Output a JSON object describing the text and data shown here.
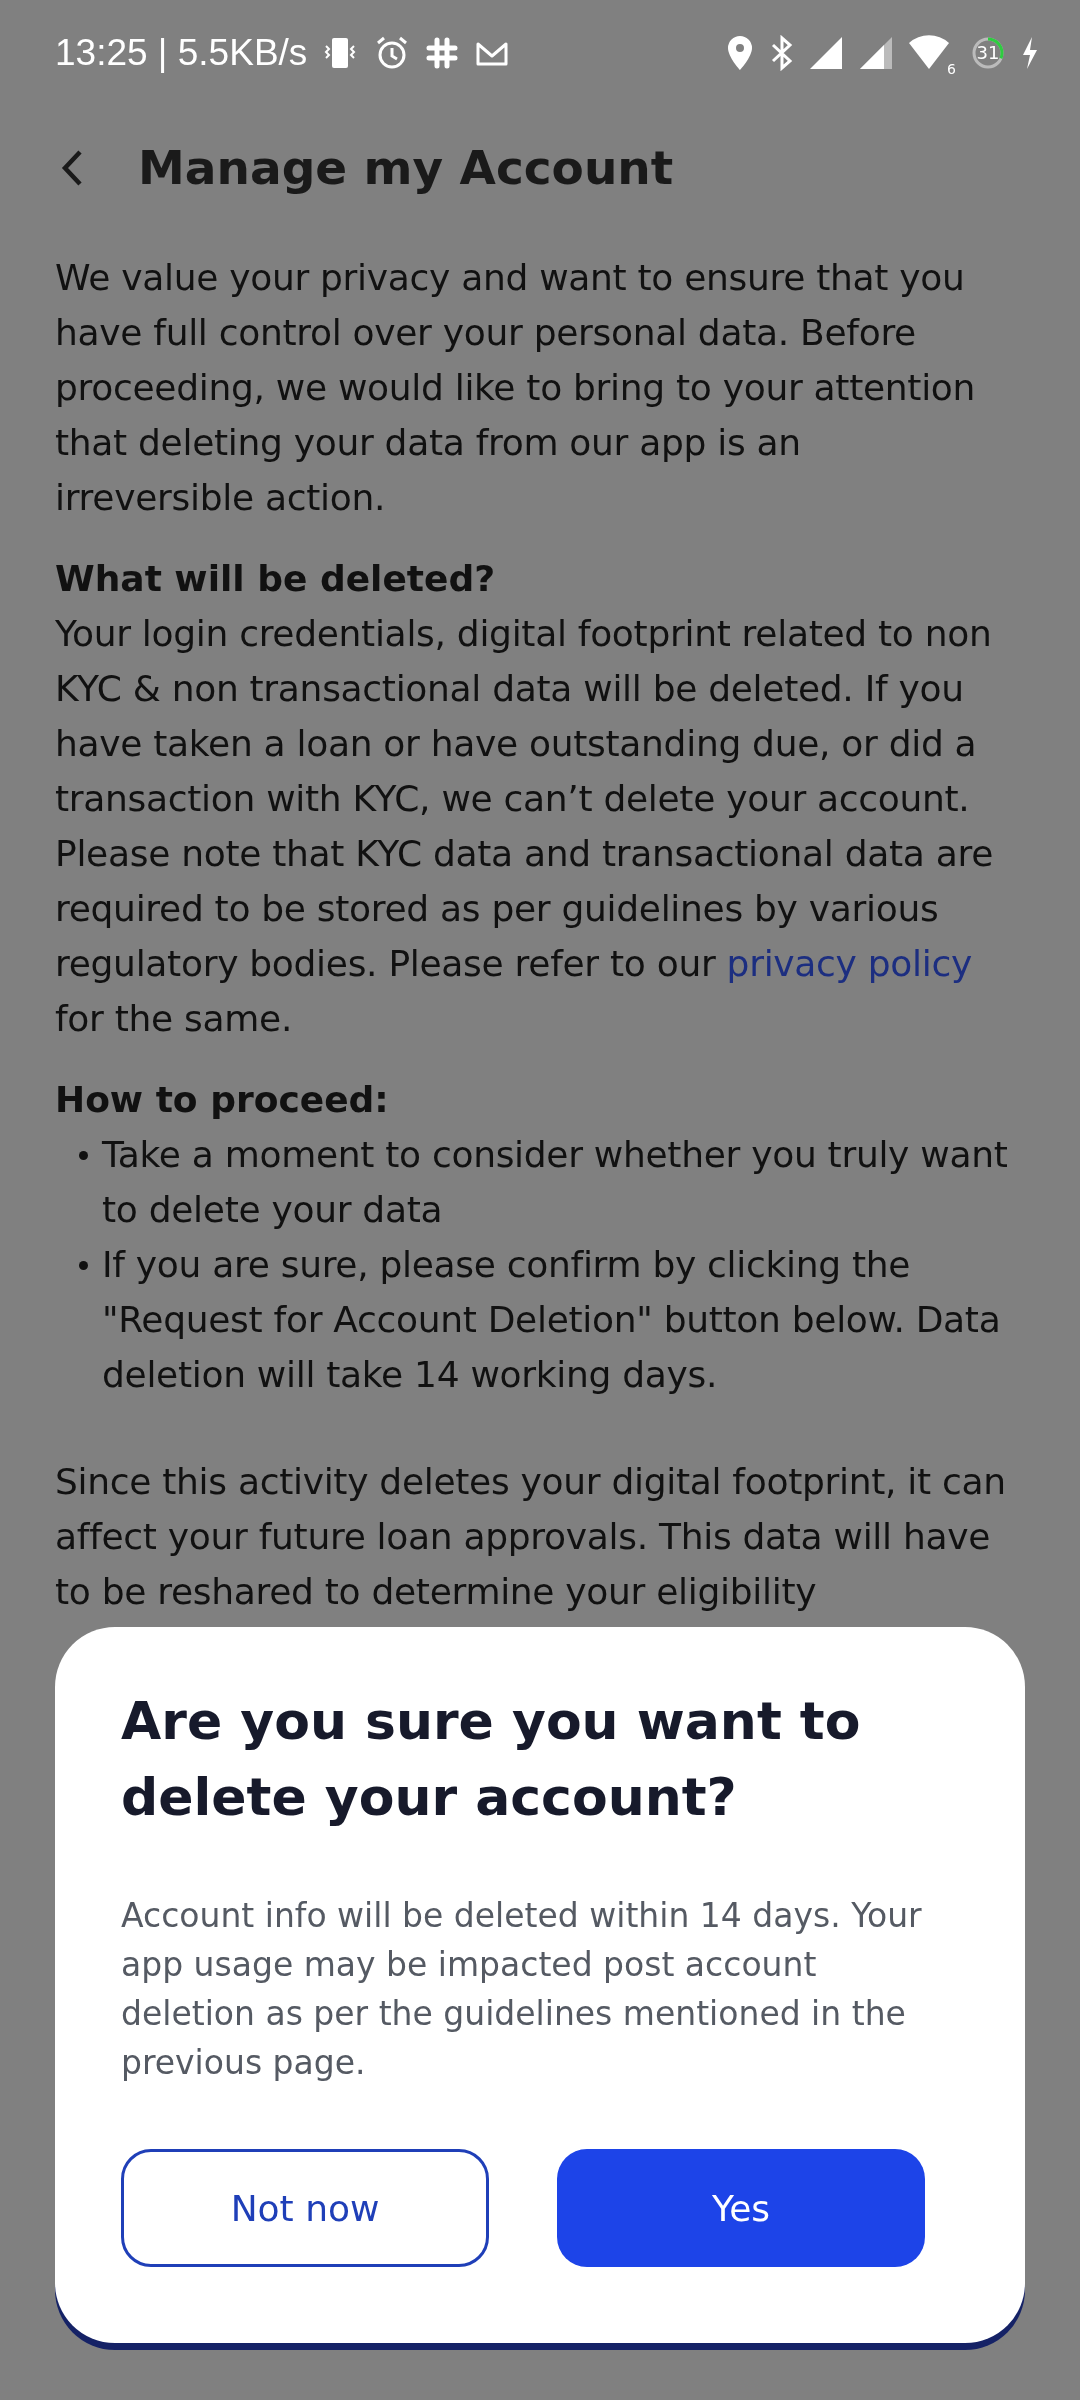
{
  "status_bar": {
    "time_speed": "13:25 | 5.5KB/s",
    "wifi_badge": "6",
    "battery": "31",
    "level": 0.31
  },
  "header": {
    "title": "Manage my Account"
  },
  "content": [
    {
      "kind": "paragraph",
      "text": "We value your privacy and want to ensure that you have full control over your personal data. Before proceeding, we would like to bring to your attention that deleting your data from our app is an irreversible action."
    },
    {
      "kind": "heading",
      "text": "What will be deleted?"
    },
    {
      "kind": "paragraph",
      "text": "Your login credentials, digital footprint related to non KYC & non transactional data will be deleted. If you have taken a loan or have outstanding due, or did a transaction with KYC, we can’t delete your account. Please note that KYC data and transactional data are required to be stored as per guidelines by various regulatory bodies. Please refer to our",
      "link": "privacy policy",
      "after": "for the same."
    },
    {
      "kind": "heading",
      "text": "How to proceed:"
    },
    {
      "kind": "bullets",
      "items": [
        "Take a moment to consider whether you truly want to delete your data",
        "If you are sure, please confirm by clicking the \"Request for Account Deletion\"  button below. Data deletion will take 14 working days."
      ]
    },
    {
      "kind": "paragraph",
      "text": "Since this activity deletes your digital footprint, it can affect your future loan approvals. This data will have to be reshared to determine your eligibility"
    }
  ],
  "dialog": {
    "title": "Are you sure you want to delete your account?",
    "message": "Account info will be deleted within 14 days. Your app usage may be impacted post account deletion as per the guidelines mentioned in the previous page.",
    "buttons": [
      {
        "label": "Not now",
        "kind": "outline"
      },
      {
        "label": "Yes",
        "kind": "filled"
      }
    ]
  }
}
